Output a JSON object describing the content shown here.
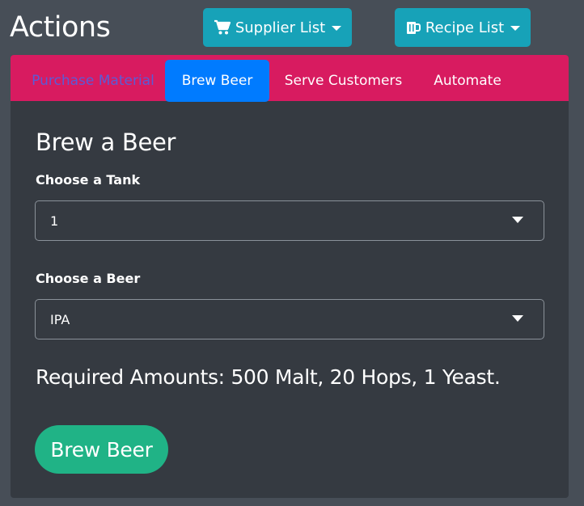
{
  "header": {
    "title": "Actions",
    "supplier_button": {
      "label": "Supplier List",
      "icon": "cart-icon"
    },
    "recipe_button": {
      "label": "Recipe List",
      "icon": "mug-icon"
    }
  },
  "tabs": [
    {
      "label": "Purchase Material",
      "state": "disabled"
    },
    {
      "label": "Brew Beer",
      "state": "active"
    },
    {
      "label": "Serve Customers",
      "state": "normal"
    },
    {
      "label": "Automate",
      "state": "normal"
    }
  ],
  "panel": {
    "title": "Brew a Beer",
    "tank_label": "Choose a Tank",
    "tank_value": "1",
    "beer_label": "Choose a Beer",
    "beer_value": "IPA",
    "required_text": "Required Amounts: 500 Malt, 20 Hops, 1 Yeast.",
    "brew_button_label": "Brew Beer"
  },
  "colors": {
    "page_bg": "#474e57",
    "card_bg": "#353a41",
    "tab_bar": "#d81b60",
    "active_tab": "#007bff",
    "info_button": "#17a2b8",
    "success_button": "#20b386"
  }
}
